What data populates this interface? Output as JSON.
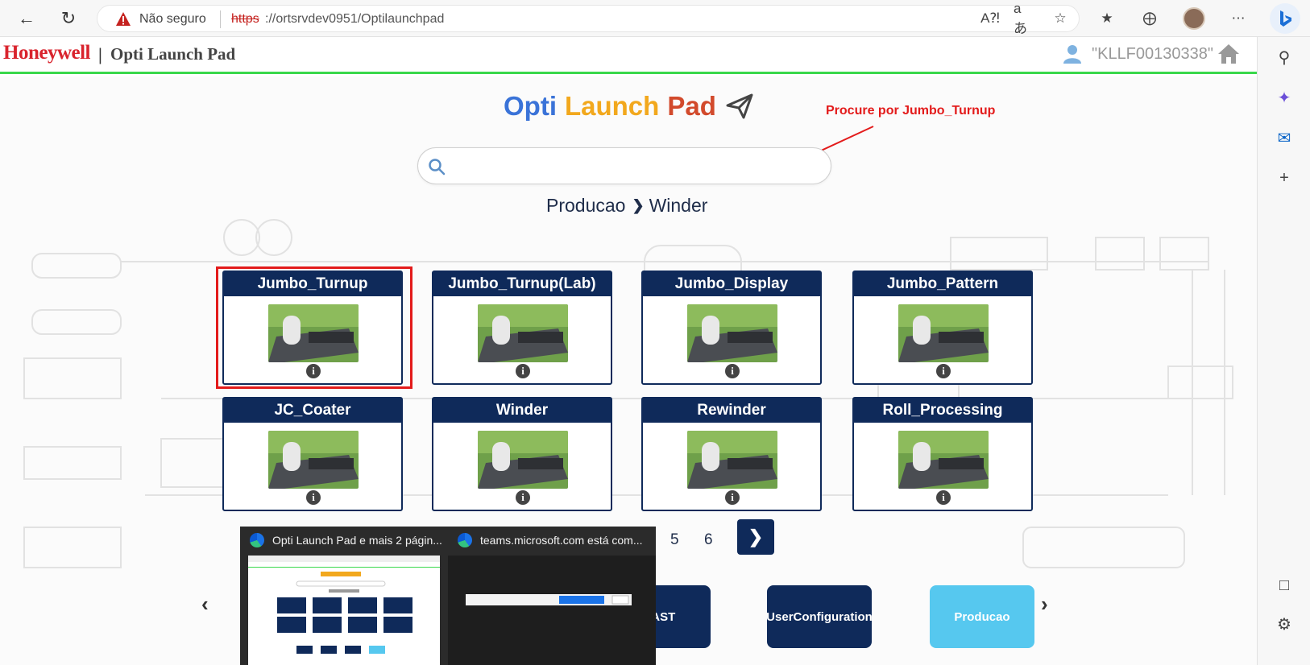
{
  "browser": {
    "security_label": "Não seguro",
    "url_protocol": "https",
    "url_rest": "://ortsrvdev0951/Optilaunchpad"
  },
  "header": {
    "brand": "Honeywell",
    "separator": "|",
    "app_title": "Opti Launch Pad",
    "user_id": "\"KLLF00130338\""
  },
  "hero": {
    "title_part1": "Opti",
    "title_part2": "Launch",
    "title_part3": "Pad",
    "annotation": "Procure por Jumbo_Turnup"
  },
  "search": {
    "placeholder": "",
    "value": ""
  },
  "breadcrumb": {
    "level1": "Producao",
    "level2": "Winder"
  },
  "cards": [
    {
      "title": "Jumbo_Turnup"
    },
    {
      "title": "Jumbo_Turnup(Lab)"
    },
    {
      "title": "Jumbo_Display"
    },
    {
      "title": "Jumbo_Pattern"
    },
    {
      "title": "JC_Coater"
    },
    {
      "title": "Winder"
    },
    {
      "title": "Rewinder"
    },
    {
      "title": "Roll_Processing"
    }
  ],
  "pagination": {
    "pages_visible": [
      "5",
      "6"
    ]
  },
  "tiles": [
    {
      "label": "MAST"
    },
    {
      "label": "UserConfiguration"
    },
    {
      "label": "Producao"
    }
  ],
  "taskbar_previews": [
    {
      "title": "Opti Launch Pad e mais 2 págin..."
    },
    {
      "title": "teams.microsoft.com está com..."
    }
  ],
  "colors": {
    "brand_red": "#d9232d",
    "header_border": "#39d84b",
    "navy": "#0f2a5a",
    "tile_active": "#56c8ef",
    "annotation_red": "#e31b1b"
  }
}
